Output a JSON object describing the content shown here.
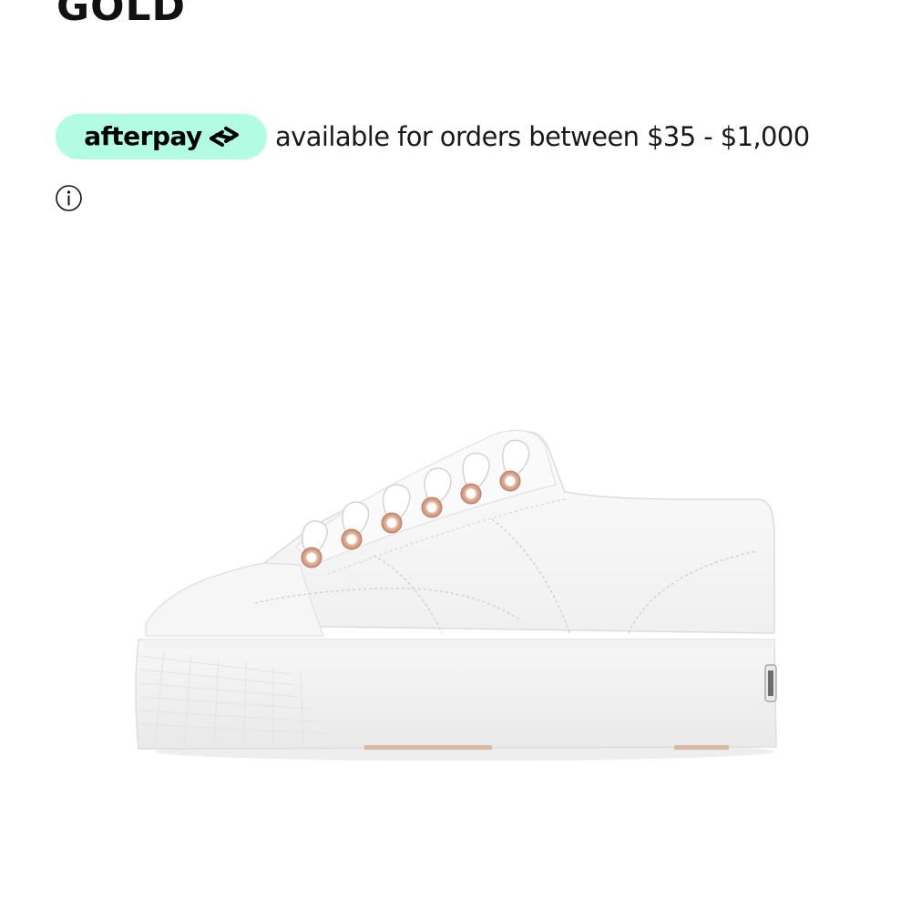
{
  "product": {
    "title": "GOLD",
    "image_icon": "sneaker-image"
  },
  "afterpay": {
    "wordmark": "afterpay",
    "logo_icon": "afterpay-arrows-icon",
    "message": "available for orders between $35 - $1,000",
    "info_icon": "info-circle-icon",
    "badge_color": "#b2fce4"
  }
}
